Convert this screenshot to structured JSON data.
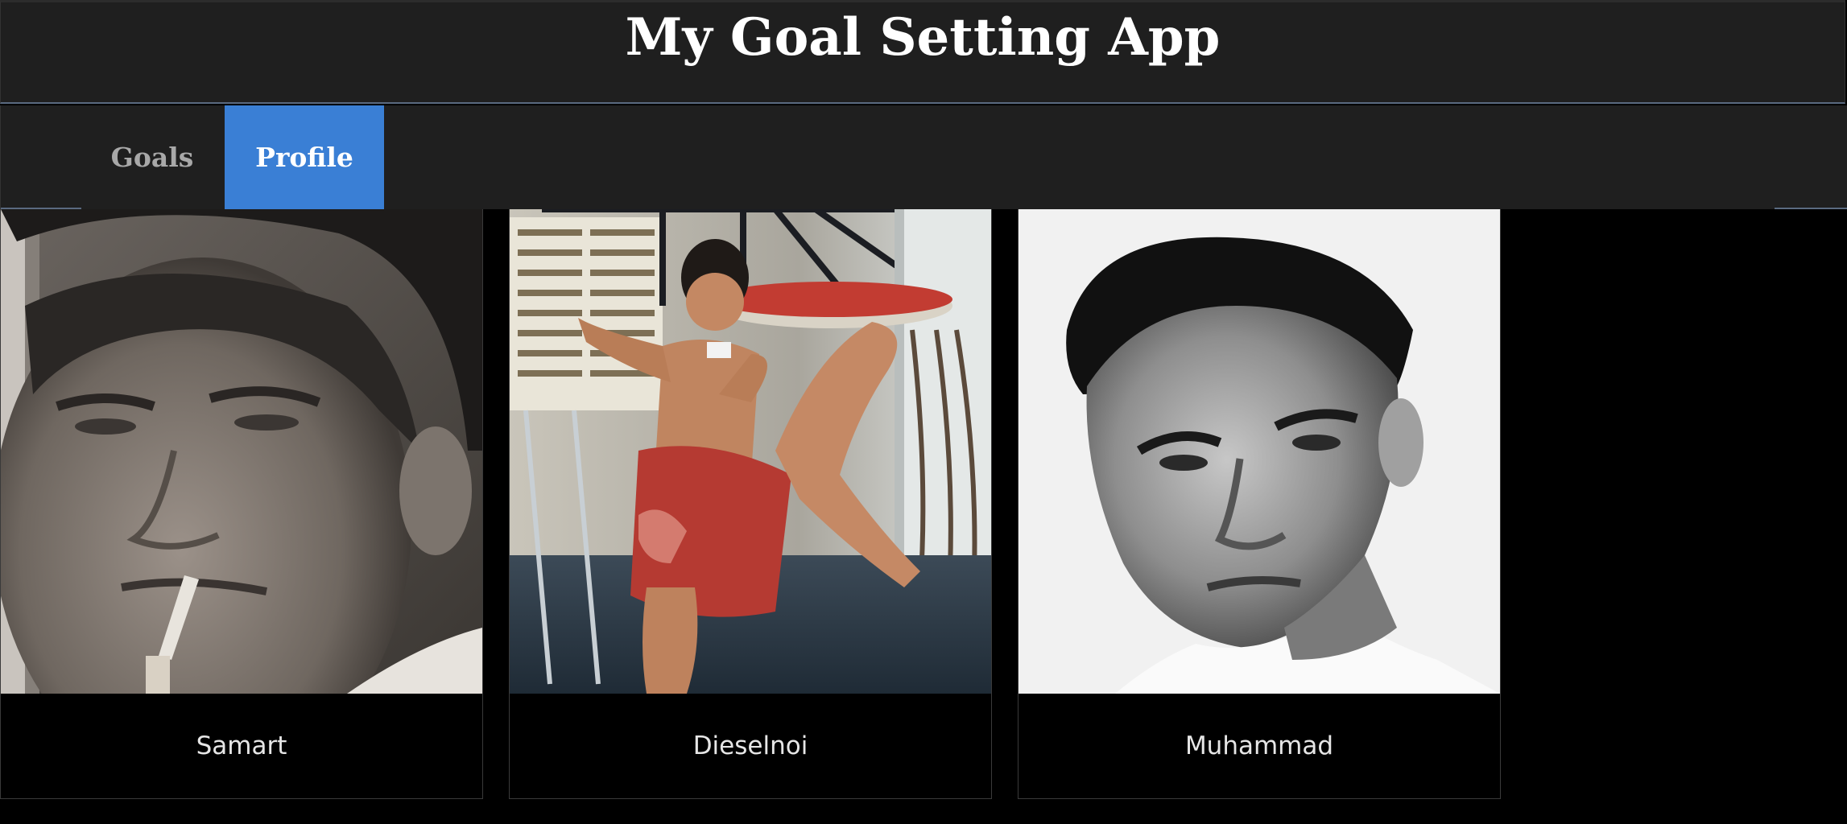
{
  "app": {
    "title": "My Goal Setting App"
  },
  "nav": {
    "tabs": [
      {
        "label": "Goals",
        "active": false
      },
      {
        "label": "Profile",
        "active": true
      }
    ]
  },
  "profiles": [
    {
      "name": "Samart",
      "photo_icon": "portrait-photo-samart"
    },
    {
      "name": "Dieselnoi",
      "photo_icon": "portrait-photo-dieselnoi"
    },
    {
      "name": "Muhammad",
      "photo_icon": "portrait-photo-muhammad"
    }
  ],
  "colors": {
    "header_bg": "#1f1f1f",
    "active_tab_bg": "#3a7fd5",
    "page_bg": "#000000",
    "inactive_tab_text": "#a8a8a8"
  }
}
